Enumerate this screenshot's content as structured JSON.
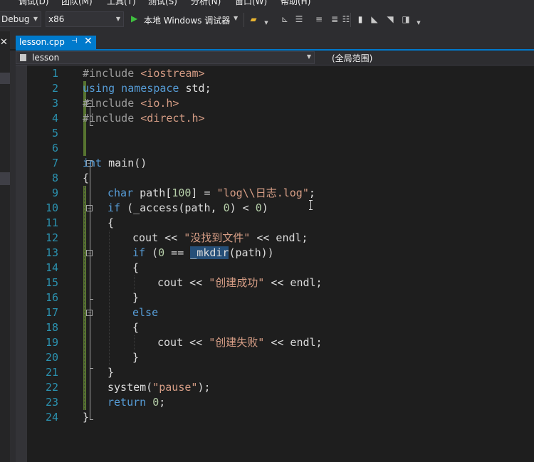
{
  "menu": {
    "items": [
      "调试(D)",
      "团队(M)",
      "工具(T)",
      "测试(S)",
      "分析(N)",
      "窗口(W)",
      "帮助(H)"
    ]
  },
  "toolbar": {
    "config_value": "Debug",
    "platform_value": "x86",
    "run_label": "本地 Windows 调试器"
  },
  "tabs": {
    "active_label": "lesson.cpp"
  },
  "navbar": {
    "project": "lesson",
    "scope": "(全局范围)"
  },
  "editor": {
    "line_numbers": [
      "1",
      "2",
      "3",
      "4",
      "5",
      "6",
      "7",
      "8",
      "9",
      "10",
      "11",
      "12",
      "13",
      "14",
      "15",
      "16",
      "17",
      "18",
      "19",
      "20",
      "21",
      "22",
      "23",
      "24"
    ],
    "lines": {
      "l1": {
        "a": "#include ",
        "b": "<iostream>"
      },
      "l2": {
        "a": "using namespace",
        "b": " std;"
      },
      "l3": {
        "a": "#include ",
        "b": "<io.h>"
      },
      "l4": {
        "a": "#include ",
        "b": "<direct.h>"
      },
      "l7": {
        "a": "int",
        "b": " main()"
      },
      "l8": {
        "a": "{"
      },
      "l9": {
        "a": "char",
        "b": " path[",
        "c": "100",
        "d": "] = ",
        "e": "\"log\\\\日志.log\"",
        "f": ";"
      },
      "l10": {
        "a": "if",
        "b": " (_access(path, ",
        "c": "0",
        "d": ") < ",
        "e": "0",
        "f": ")"
      },
      "l11": {
        "a": "{"
      },
      "l12": {
        "a": "cout << ",
        "b": "\"没找到文件\"",
        "c": " << endl;"
      },
      "l13": {
        "a": "if",
        "b": " (",
        "c": "0",
        "d": " == ",
        "e": "_mkdir",
        "f": "(path))"
      },
      "l14": {
        "a": "{"
      },
      "l15": {
        "a": "cout << ",
        "b": "\"创建成功\"",
        "c": " << endl;"
      },
      "l16": {
        "a": "}"
      },
      "l17": {
        "a": "else"
      },
      "l18": {
        "a": "{"
      },
      "l19": {
        "a": "cout << ",
        "b": "\"创建失败\"",
        "c": " << endl;"
      },
      "l20": {
        "a": "}"
      },
      "l21": {
        "a": "}"
      },
      "l22": {
        "a": "system(",
        "b": "\"pause\"",
        "c": ");"
      },
      "l23": {
        "a": "return",
        "b": " ",
        "c": "0",
        "d": ";"
      },
      "l24": {
        "a": "}"
      }
    }
  },
  "colors": {
    "accent": "#007acc",
    "keyword": "#569cd6",
    "string": "#d69d85",
    "line_number": "#2b91af",
    "change_bar": "#577430"
  },
  "icons": [
    "close-icon",
    "pin-icon",
    "play-icon",
    "file-icon",
    "fold-toggle-icon",
    "bookmark-icon"
  ]
}
